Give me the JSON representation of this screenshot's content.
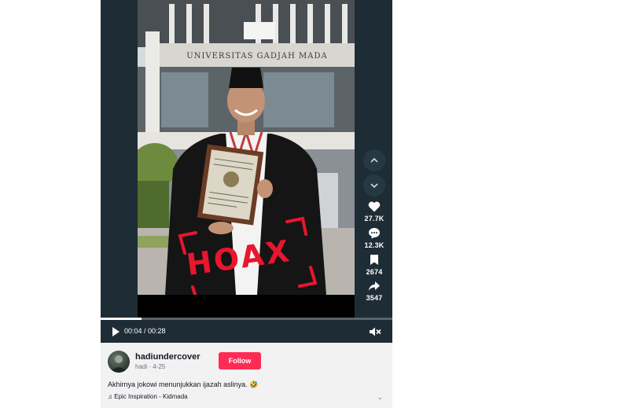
{
  "video": {
    "building_sign": "UNIVERSITAS GADJAH MADA",
    "stamp_text": "HOAX"
  },
  "rail": {
    "prev_icon": "chevron-up-icon",
    "next_icon": "chevron-down-icon",
    "likes": "27.7K",
    "comments": "12.3K",
    "saves": "2674",
    "shares": "3547"
  },
  "player": {
    "time": "00:04 / 00:28",
    "progress": 0.14,
    "mute_icon": "muted-speaker-icon"
  },
  "post": {
    "username": "hadiundercover",
    "meta": "hadi · 4-25",
    "follow_label": "Follow",
    "caption": "Akhirnya jokowi menunjukkan ijazah aslinya. 🤣",
    "music": "Epic Inspiration - Kidmada"
  },
  "colors": {
    "follow": "#fe2c55",
    "player_bg": "#1e2d35",
    "stamp": "#e8162e"
  }
}
